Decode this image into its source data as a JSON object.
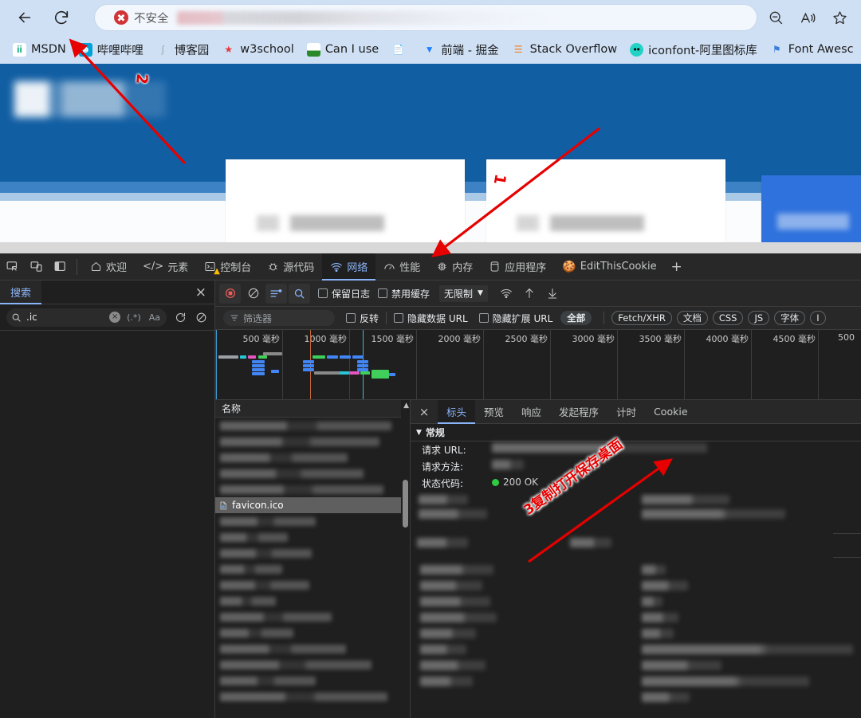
{
  "browser": {
    "back_label": "Back",
    "reload_label": "Reload",
    "security_text": "不安全",
    "security_icon": "not-secure-icon",
    "zoom_out_label": "Zoom out",
    "read_aloud_label": "Read aloud",
    "favorite_label": "Add to favorites",
    "bookmarks": [
      {
        "label": "MSDN",
        "icon": "msdn-icon"
      },
      {
        "label": "哔哩哔哩",
        "icon": "bilibili-icon"
      },
      {
        "label": "博客园",
        "icon": "cnblogs-icon"
      },
      {
        "label": "w3school",
        "icon": "w3school-icon"
      },
      {
        "label": "Can I use",
        "icon": "caniuse-icon"
      },
      {
        "label": "",
        "icon": "page-icon"
      },
      {
        "label": "前端 - 掘金",
        "icon": "juejin-icon"
      },
      {
        "label": "Stack Overflow",
        "icon": "stackoverflow-icon"
      },
      {
        "label": "iconfont-阿里图标库",
        "icon": "iconfont-icon"
      },
      {
        "label": "Font Awesc",
        "icon": "fontawesome-icon"
      }
    ]
  },
  "devtools": {
    "inspect_label": "Inspect element",
    "device_toolbar_label": "Toggle device toolbar",
    "dock_label": "Dock side",
    "tabs": [
      {
        "label": "欢迎",
        "icon": "home-icon",
        "active": false
      },
      {
        "label": "元素",
        "icon": "code-icon",
        "active": false
      },
      {
        "label": "控制台",
        "icon": "console-icon",
        "active": false,
        "warning": true
      },
      {
        "label": "源代码",
        "icon": "bug-icon",
        "active": false
      },
      {
        "label": "网络",
        "icon": "network-icon",
        "active": true
      },
      {
        "label": "性能",
        "icon": "performance-icon",
        "active": false
      },
      {
        "label": "内存",
        "icon": "memory-icon",
        "active": false
      },
      {
        "label": "应用程序",
        "icon": "application-icon",
        "active": false
      },
      {
        "label": "EditThisCookie",
        "icon": "cookie-icon",
        "active": false
      }
    ],
    "more_tabs_label": "+",
    "search_drawer": {
      "tab_label": "搜索",
      "close_label": "×",
      "query": ".ic",
      "clear_label": "×",
      "regex_label": "(.*)",
      "match_case_label": "Aa",
      "refresh_label": "Refresh",
      "clear_results_label": "Clear"
    },
    "network": {
      "record_label": "Record",
      "clear_label": "Clear",
      "filter_toggle_label": "Filter",
      "search_label": "Search",
      "preserve_log_label": "保留日志",
      "disable_cache_label": "禁用缓存",
      "throttle_value": "无限制",
      "throttle_caret": "▼",
      "network_conditions_label": "Network conditions",
      "import_har_label": "Import HAR",
      "export_har_label": "Export HAR",
      "filter_placeholder": "筛选器",
      "invert_label": "反转",
      "hide_data_urls_label": "隐藏数据 URL",
      "hide_ext_urls_label": "隐藏扩展 URL",
      "type_filters": [
        "全部",
        "Fetch/XHR",
        "文档",
        "CSS",
        "JS",
        "字体",
        "I"
      ],
      "active_type_filter": "全部",
      "timeline_ticks": [
        "500 毫秒",
        "1000 毫秒",
        "1500 毫秒",
        "2000 毫秒",
        "2500 毫秒",
        "3000 毫秒",
        "3500 毫秒",
        "4000 毫秒",
        "4500 毫秒",
        "500"
      ],
      "list_header": "名称",
      "selected_request": "favicon.ico",
      "selected_request_icon": "file-icon",
      "details": {
        "tabs": [
          "标头",
          "预览",
          "响应",
          "发起程序",
          "计时",
          "Cookie"
        ],
        "active_tab": "标头",
        "close_label": "×",
        "section_title": "常规",
        "section_caret": "▼",
        "rows": [
          {
            "key": "请求 URL:",
            "value": "",
            "blurred": true
          },
          {
            "key": "请求方法:",
            "value": "GET",
            "blurred": true
          },
          {
            "key": "状态代码:",
            "value": "200 OK",
            "blurred": false,
            "status_dot": "#2ecc40"
          }
        ]
      }
    }
  },
  "annotations": [
    {
      "id": "1",
      "label": "1",
      "target": "network-tab"
    },
    {
      "id": "2",
      "label": "2",
      "target": "reload-button"
    },
    {
      "id": "3",
      "label": "3复制打开保存桌面",
      "target": "request-url-value"
    }
  ]
}
